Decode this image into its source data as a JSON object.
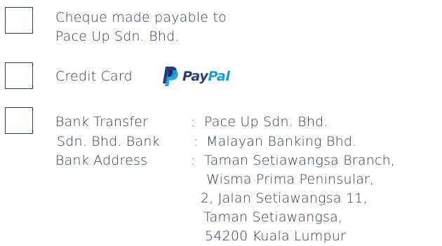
{
  "options": [
    {
      "id": "cheque",
      "lines": [
        "Cheque made payable to",
        "Pace Up Sdn. Bhd."
      ]
    },
    {
      "id": "credit-card",
      "label": "Credit Card",
      "brand": {
        "word1": "Pay",
        "word2": "Pal",
        "color1": "#253b80",
        "color2": "#179bd7",
        "icon": "paypal-logo-icon"
      }
    },
    {
      "id": "bank-transfer",
      "rows": [
        {
          "label": "Bank Transfer",
          "sep": ":",
          "value": "Pace Up Sdn. Bhd."
        },
        {
          "label": "Sdn. Bhd. Bank",
          "sep": ":",
          "value": "Malayan Banking Bhd."
        },
        {
          "label": "Bank Address",
          "sep": ":",
          "value": "Taman Setiawangsa Branch,"
        }
      ],
      "address_lines": [
        "Wisma Prima Peninsular,",
        "2, Jalan Setiawangsa 11,",
        "Taman Setiawangsa,",
        "54200 Kuala Lumpur"
      ]
    }
  ],
  "colors": {
    "text": "#2f3a56",
    "border": "#2f3a56"
  }
}
